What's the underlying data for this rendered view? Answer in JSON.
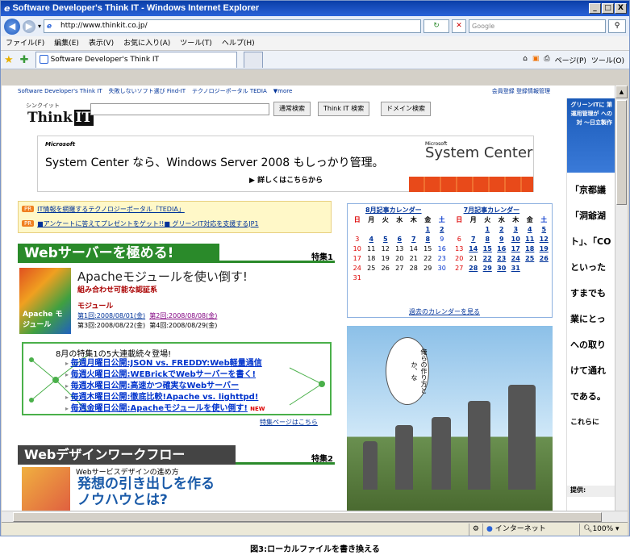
{
  "window": {
    "title": "Software Developer's Think IT - Windows Internet Explorer",
    "min": "_",
    "max": "□",
    "close": "X"
  },
  "address": {
    "url": "http://www.thinkit.co.jp/",
    "search_placeholder": "Google"
  },
  "menu": [
    "ファイル(F)",
    "編集(E)",
    "表示(V)",
    "お気に入り(A)",
    "ツール(T)",
    "ヘルプ(H)"
  ],
  "tab": {
    "label": "Software Developer's Think IT"
  },
  "toolbar": {
    "page": "ページ(P)",
    "tools": "ツール(O)"
  },
  "toplinks": {
    "a": "Software Developer's Think IT",
    "b": "失敗しないソフト選び Find-IT",
    "c": "テクノロジーポータル TEDIA",
    "more": "▼more",
    "right": "会員登録 登録情報管理"
  },
  "logo": {
    "kana": "シンクイット",
    "brand1": "Think",
    "brand2": "IT",
    "tm": "™"
  },
  "search_buttons": [
    "通常検索",
    "Think IT 検索",
    "ドメイン検索"
  ],
  "banner": {
    "ms": "Microsoft",
    "message": "System Center なら、Windows Server 2008 もしっかり管理。",
    "more": "詳しくはこちらから",
    "sc_small": "Microsoft",
    "sc": "System Center"
  },
  "pr": [
    {
      "badge": "PR",
      "text": "IT情報を網羅するテクノロジーポータル「TEDIA」"
    },
    {
      "badge": "PR",
      "text": "■アンケートに答えてプレゼントをゲット!!■ グリーンIT対応を支援するJP1"
    }
  ],
  "feature1": {
    "title": "Webサーバーを極める!",
    "tag": "特集1",
    "headline": "Apacheモジュールを使い倒す!",
    "sub": "組み合わせ可能な認証系",
    "category": "モジュール",
    "ep1": "第1回:2008/08/01(金)",
    "ep2": "第2回:2008/08/08(金)",
    "ep3": "第3回:2008/08/22(金)",
    "ep4": "第4回:2008/08/29(金)",
    "img": "Apache モジュール"
  },
  "series": {
    "title": "8月の特集1の5大連載続々登場!",
    "items": [
      "毎週月曜日公開:JSON vs. FREDDY:Web軽量通信",
      "毎週火曜日公開:WEBrickでWebサーバーを書く!",
      "毎週水曜日公開:高速かつ確実なWebサーバー",
      "毎週木曜日公開:徹底比較!Apache vs. lighttpd!",
      "毎週金曜日公開:Apacheモジュールを使い倒す!"
    ],
    "new": "NEW",
    "link": "特集ページはこちら"
  },
  "feature2": {
    "title": "Webデザインワークフロー",
    "tag": "特集2",
    "small": "Webサービスデザインの進め方",
    "headline1": "発想の引き出しを作る",
    "headline2": "ノウハウとは?"
  },
  "calendar": {
    "aug": "8月記事カレンダー",
    "jul": "7月記事カレンダー",
    "days": [
      "日",
      "月",
      "火",
      "水",
      "木",
      "金",
      "土"
    ],
    "old": "過去のカレンダーを見る",
    "rows": [
      [
        [
          "",
          ""
        ],
        [
          "",
          ""
        ],
        [
          "",
          ""
        ],
        [
          "",
          ""
        ],
        [
          "",
          ""
        ],
        [
          "1",
          "lk"
        ],
        [
          "2",
          "lk"
        ],
        [
          "",
          ""
        ],
        [
          "",
          ""
        ],
        [
          "1",
          "lk"
        ],
        [
          "2",
          "lk"
        ],
        [
          "3",
          "lk"
        ],
        [
          "4",
          "lk"
        ],
        [
          "5",
          "lk"
        ]
      ],
      [
        [
          "3",
          ""
        ],
        [
          "4",
          "lk"
        ],
        [
          "5",
          "lk"
        ],
        [
          "6",
          "lk"
        ],
        [
          "7",
          "lk"
        ],
        [
          "8",
          "lk"
        ],
        [
          "9",
          ""
        ],
        [
          "6",
          ""
        ],
        [
          "7",
          "lk"
        ],
        [
          "8",
          "lk"
        ],
        [
          "9",
          "lk"
        ],
        [
          "10",
          "lk"
        ],
        [
          "11",
          "lk"
        ],
        [
          "12",
          "lk"
        ]
      ],
      [
        [
          "10",
          ""
        ],
        [
          "11",
          ""
        ],
        [
          "12",
          ""
        ],
        [
          "13",
          ""
        ],
        [
          "14",
          ""
        ],
        [
          "15",
          ""
        ],
        [
          "16",
          ""
        ],
        [
          "13",
          ""
        ],
        [
          "14",
          "lk"
        ],
        [
          "15",
          "lk"
        ],
        [
          "16",
          "lk"
        ],
        [
          "17",
          "lk"
        ],
        [
          "18",
          "lk"
        ],
        [
          "19",
          "lk"
        ]
      ],
      [
        [
          "17",
          ""
        ],
        [
          "18",
          ""
        ],
        [
          "19",
          ""
        ],
        [
          "20",
          ""
        ],
        [
          "21",
          ""
        ],
        [
          "22",
          ""
        ],
        [
          "23",
          ""
        ],
        [
          "20",
          ""
        ],
        [
          "21",
          ""
        ],
        [
          "22",
          "lk"
        ],
        [
          "23",
          "lk"
        ],
        [
          "24",
          "lk"
        ],
        [
          "25",
          "lk"
        ],
        [
          "26",
          "lk"
        ]
      ],
      [
        [
          "24",
          ""
        ],
        [
          "25",
          ""
        ],
        [
          "26",
          ""
        ],
        [
          "27",
          ""
        ],
        [
          "28",
          ""
        ],
        [
          "29",
          ""
        ],
        [
          "30",
          ""
        ],
        [
          "27",
          ""
        ],
        [
          "28",
          "lk"
        ],
        [
          "29",
          "lk"
        ],
        [
          "30",
          "lk"
        ],
        [
          "31",
          "lk"
        ],
        [
          "",
          ""
        ],
        [
          "",
          ""
        ]
      ],
      [
        [
          "31",
          ""
        ],
        [
          "",
          ""
        ],
        [
          "",
          ""
        ],
        [
          "",
          ""
        ],
        [
          "",
          ""
        ],
        [
          "",
          ""
        ],
        [
          "",
          ""
        ],
        [
          "",
          ""
        ],
        [
          "",
          ""
        ],
        [
          "",
          ""
        ],
        [
          "",
          ""
        ],
        [
          "",
          ""
        ],
        [
          "",
          ""
        ],
        [
          "",
          ""
        ]
      ]
    ]
  },
  "photo": {
    "bubble": "俺らの作り方とか、な"
  },
  "side": {
    "head": "グリーンITに 第 運用管理が への対 〜日立製作",
    "lines": [
      "「京都議",
      "「洞爺湖",
      "ト」、「CO",
      "といった",
      "すまでも",
      "業にとっ",
      "への取り",
      "けて通れ",
      "である。",
      "これらに"
    ],
    "provider": "提供:"
  },
  "status": {
    "zone": "インターネット",
    "zoom": "100%"
  },
  "caption": "図3:ローカルファイルを書き換える"
}
